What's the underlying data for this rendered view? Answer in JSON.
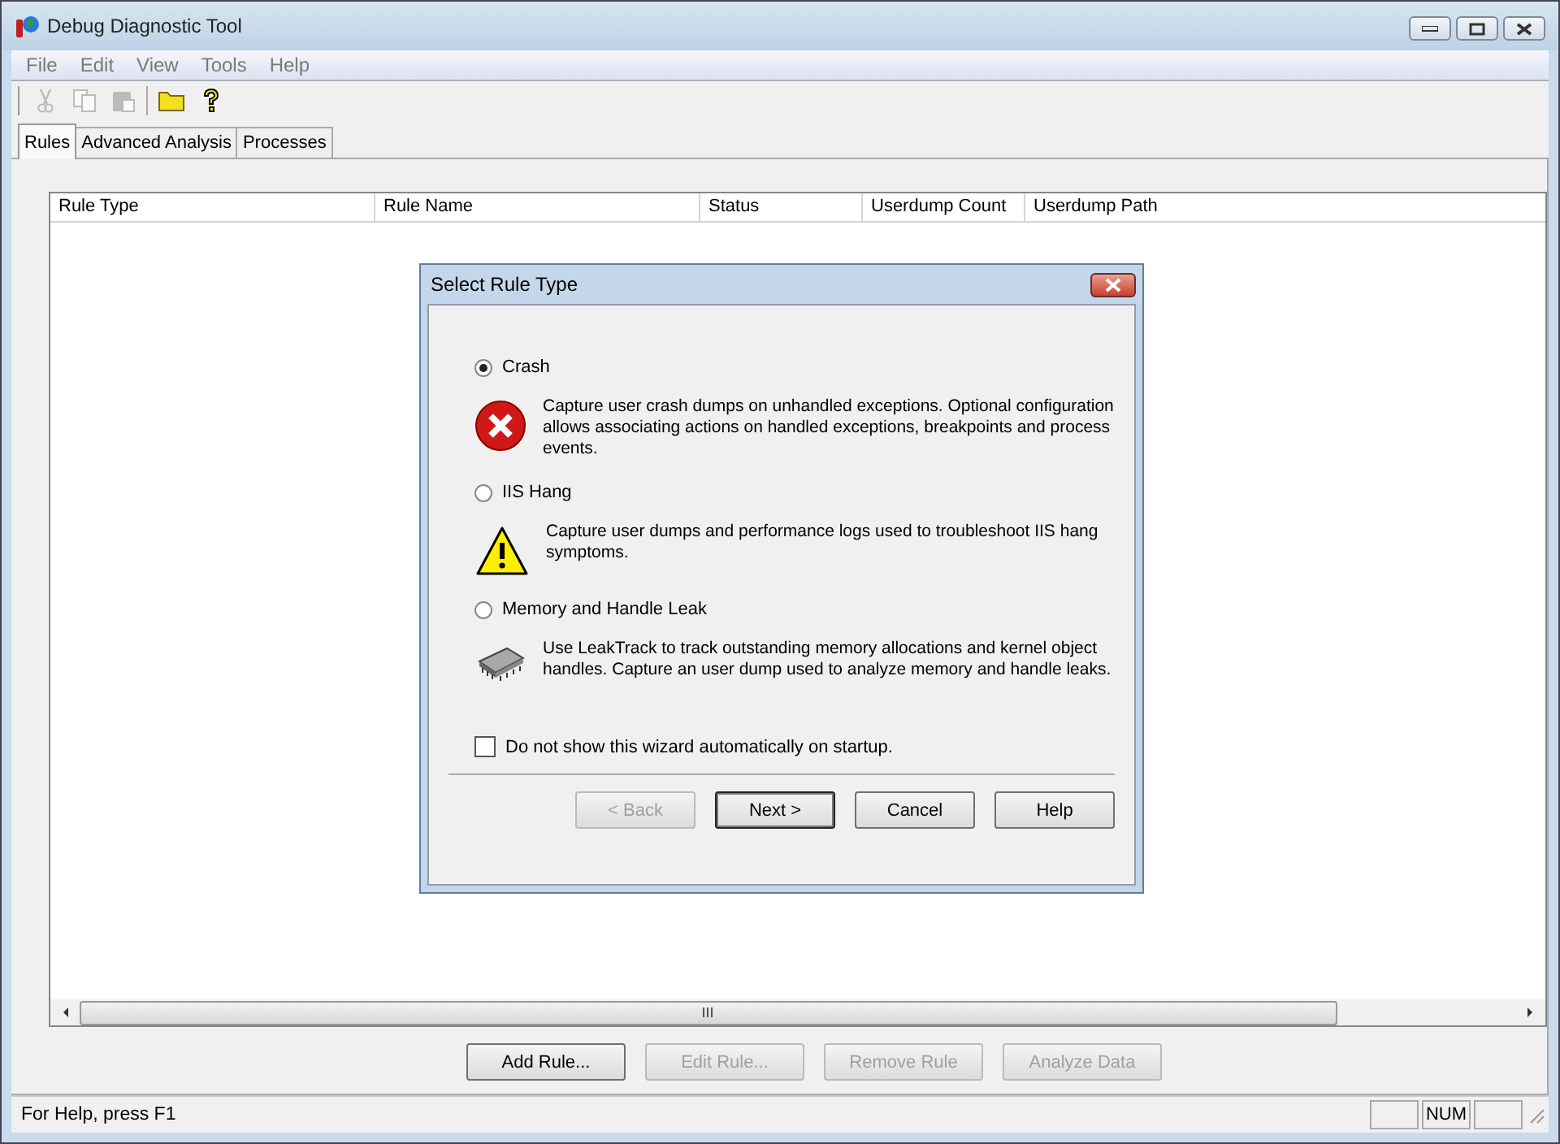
{
  "window": {
    "title": "Debug Diagnostic Tool"
  },
  "menu": [
    "File",
    "Edit",
    "View",
    "Tools",
    "Help"
  ],
  "toolbar": [
    {
      "kind": "cut",
      "disabled": true
    },
    {
      "kind": "copy",
      "disabled": true
    },
    {
      "kind": "paste",
      "disabled": true
    },
    {
      "kind": "open",
      "disabled": false
    },
    {
      "kind": "help",
      "disabled": false
    }
  ],
  "tabs": [
    {
      "label": "Rules",
      "selected": true
    },
    {
      "label": "Advanced Analysis",
      "selected": false
    },
    {
      "label": "Processes",
      "selected": false
    }
  ],
  "table": {
    "columns": [
      "Rule Type",
      "Rule Name",
      "Status",
      "Userdump Count",
      "Userdump Path"
    ]
  },
  "buttons": [
    {
      "label": "Add Rule...",
      "disabled": false
    },
    {
      "label": "Edit Rule...",
      "disabled": true
    },
    {
      "label": "Remove Rule",
      "disabled": true
    },
    {
      "label": "Analyze Data",
      "disabled": true
    }
  ],
  "dialog": {
    "title": "Select Rule Type",
    "options": [
      {
        "label": "Crash",
        "selected": true,
        "kind": "error",
        "description": "Capture user crash dumps on unhandled exceptions. Optional configuration allows associating actions on handled exceptions, breakpoints and process events."
      },
      {
        "label": "IIS Hang",
        "selected": false,
        "kind": "warning",
        "description": "Capture user dumps and performance logs used to troubleshoot IIS hang symptoms."
      },
      {
        "label": "Memory and Handle Leak",
        "selected": false,
        "kind": "chip",
        "description": "Use LeakTrack to track outstanding memory allocations and kernel object handles. Capture an user dump used to analyze memory and handle leaks."
      }
    ],
    "checkbox": {
      "label": "Do not show this wizard automatically on startup.",
      "checked": false
    },
    "buttons": [
      {
        "label": "< Back",
        "disabled": true,
        "default": false
      },
      {
        "label": "Next >",
        "disabled": false,
        "default": true
      },
      {
        "label": "Cancel",
        "disabled": false,
        "default": false
      },
      {
        "label": "Help",
        "disabled": false,
        "default": false
      }
    ]
  },
  "status_bar": {
    "text": "For Help, press F1",
    "panes": [
      "NUM"
    ]
  }
}
